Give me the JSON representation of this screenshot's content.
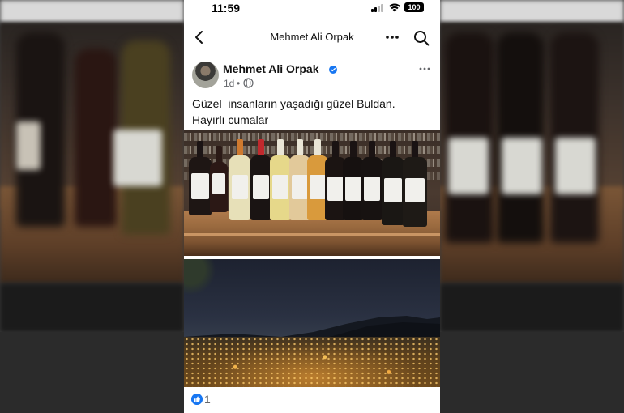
{
  "status_bar": {
    "time": "11:59",
    "battery": "100",
    "icons": [
      "signal-icon",
      "wifi-icon",
      "battery-icon"
    ]
  },
  "nav": {
    "title": "Mehmet Ali Orpak",
    "icons": [
      "back-icon",
      "more-icon",
      "search-icon"
    ]
  },
  "post": {
    "author": "Mehmet Ali Orpak",
    "time": "1d",
    "separator": "•",
    "text": "Güzel  insanların yaşadığı güzel Buldan.\nHayırlı cumalar",
    "photos": [
      "wine-bottles-photo",
      "night-city-photo"
    ],
    "reactions": {
      "like_count": "1"
    }
  },
  "colors": {
    "brand_blue": "#1877f2",
    "secondary_text": "#65676b"
  }
}
